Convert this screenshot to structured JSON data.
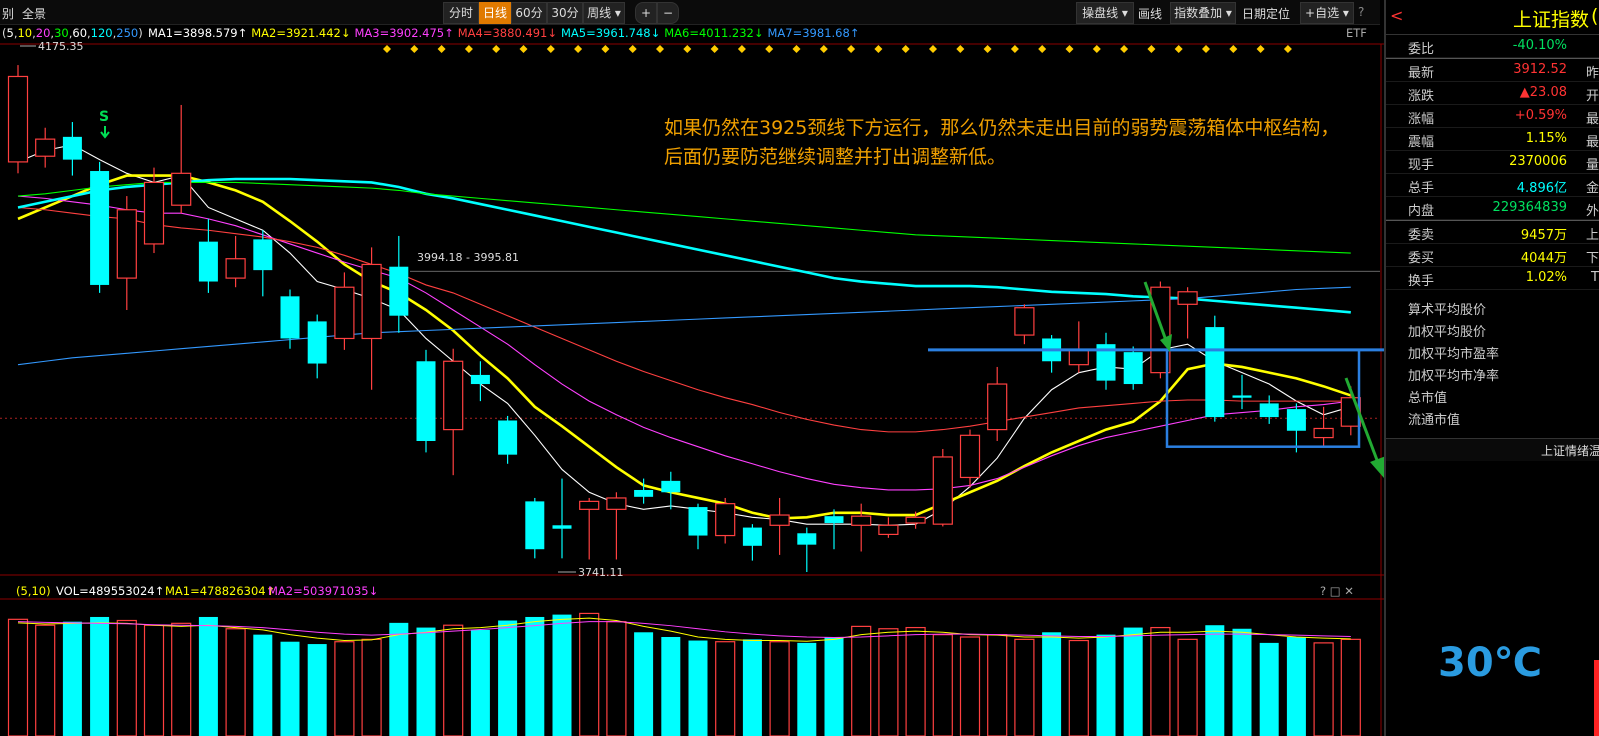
{
  "toolbar": {
    "left_cut": "别",
    "full_view": "全景",
    "period_tabs": [
      "分时",
      "日线",
      "60分",
      "30分",
      "周线"
    ],
    "active_period": "日线",
    "plus": "+",
    "minus": "−",
    "panel_line": "操盘线",
    "draw_line": "画线",
    "index_overlay": "指数叠加",
    "date_locate": "日期定位",
    "watchlist": "+自选",
    "help": "?",
    "collapse": "❯❮"
  },
  "ma_legend": {
    "params_prefix": "(",
    "params": [
      {
        "text": "5",
        "color": "#ffffff"
      },
      {
        "text": "10",
        "color": "#ffff00"
      },
      {
        "text": "20",
        "color": "#ff40ff"
      },
      {
        "text": "30",
        "color": "#00ff00"
      },
      {
        "text": "60",
        "color": "#ffffff"
      },
      {
        "text": "120",
        "color": "#00ffff"
      },
      {
        "text": "250",
        "color": "#3399ff"
      }
    ],
    "items": [
      {
        "text": "MA1=3898.579↑",
        "color": "#ffffff"
      },
      {
        "text": "MA2=3921.442↓",
        "color": "#ffff00"
      },
      {
        "text": "MA3=3902.475↑",
        "color": "#ff40ff"
      },
      {
        "text": "MA4=3880.491↓",
        "color": "#ff4040"
      },
      {
        "text": "MA5=3961.748↓",
        "color": "#00ffff"
      },
      {
        "text": "MA6=4011.232↓",
        "color": "#00ff00"
      },
      {
        "text": "MA7=3981.68↑",
        "color": "#3399ff"
      }
    ],
    "etf": "ETF",
    "help": "?"
  },
  "volume_legend": {
    "params": "(5,10)",
    "vol": "VOL=489553024↑",
    "ma1": "MA1=478826304↑",
    "ma2": "MA2=503971035↓",
    "controls": "? □ ✕"
  },
  "annotation": {
    "line1": "如果仍然在3925颈线下方运行，那么仍然未走出目前的弱势震荡箱体中枢结构，",
    "line2": "后面仍要防范继续调整并打出调整新低。"
  },
  "chart_data": {
    "type": "candlestick",
    "title": "",
    "xlabel": "",
    "ylabel": "",
    "ylim": [
      3730,
      4190
    ],
    "high_label": "4175.35",
    "low_label": "3741.11",
    "range_label": "3994.18 - 3995.81",
    "reference_price": 3925,
    "candles": [
      {
        "o": 4090,
        "c": 4165,
        "h": 4175,
        "l": 4080
      },
      {
        "o": 4095,
        "c": 4110,
        "h": 4120,
        "l": 4085
      },
      {
        "o": 4112,
        "c": 4092,
        "h": 4125,
        "l": 4078
      },
      {
        "o": 4082,
        "c": 3982,
        "h": 4090,
        "l": 3975
      },
      {
        "o": 3988,
        "c": 4048,
        "h": 4060,
        "l": 3960
      },
      {
        "o": 4018,
        "c": 4072,
        "h": 4085,
        "l": 4010
      },
      {
        "o": 4052,
        "c": 4080,
        "h": 4140,
        "l": 4045
      },
      {
        "o": 4020,
        "c": 3985,
        "h": 4040,
        "l": 3975
      },
      {
        "o": 3988,
        "c": 4005,
        "h": 4025,
        "l": 3980
      },
      {
        "o": 4022,
        "c": 3995,
        "h": 4030,
        "l": 3972
      },
      {
        "o": 3972,
        "c": 3935,
        "h": 3978,
        "l": 3926
      },
      {
        "o": 3950,
        "c": 3913,
        "h": 3956,
        "l": 3900
      },
      {
        "o": 3935,
        "c": 3980,
        "h": 3993,
        "l": 3925
      },
      {
        "o": 3935,
        "c": 4000,
        "h": 4015,
        "l": 3890
      },
      {
        "o": 3998,
        "c": 3955,
        "h": 4025,
        "l": 3940
      },
      {
        "o": 3915,
        "c": 3845,
        "h": 3925,
        "l": 3835
      },
      {
        "o": 3855,
        "c": 3915,
        "h": 3926,
        "l": 3815
      },
      {
        "o": 3903,
        "c": 3895,
        "h": 3915,
        "l": 3880
      },
      {
        "o": 3863,
        "c": 3833,
        "h": 3867,
        "l": 3825
      },
      {
        "o": 3792,
        "c": 3750,
        "h": 3795,
        "l": 3742
      },
      {
        "o": 3771,
        "c": 3768,
        "h": 3812,
        "l": 3742
      },
      {
        "o": 3785,
        "c": 3792,
        "h": 3795,
        "l": 3741
      },
      {
        "o": 3785,
        "c": 3795,
        "h": 3800,
        "l": 3741
      },
      {
        "o": 3802,
        "c": 3796,
        "h": 3812,
        "l": 3790
      },
      {
        "o": 3810,
        "c": 3800,
        "h": 3818,
        "l": 3785
      },
      {
        "o": 3787,
        "c": 3762,
        "h": 3790,
        "l": 3750
      },
      {
        "o": 3762,
        "c": 3790,
        "h": 3795,
        "l": 3755
      },
      {
        "o": 3769,
        "c": 3753,
        "h": 3772,
        "l": 3740
      },
      {
        "o": 3771,
        "c": 3780,
        "h": 3795,
        "l": 3745
      },
      {
        "o": 3764,
        "c": 3754,
        "h": 3769,
        "l": 3730
      },
      {
        "o": 3779,
        "c": 3773,
        "h": 3785,
        "l": 3750
      },
      {
        "o": 3771,
        "c": 3779,
        "h": 3790,
        "l": 3748
      },
      {
        "o": 3763,
        "c": 3771,
        "h": 3778,
        "l": 3760
      },
      {
        "o": 3773,
        "c": 3778,
        "h": 3783,
        "l": 3768
      },
      {
        "o": 3772,
        "c": 3831,
        "h": 3838,
        "l": 3770
      },
      {
        "o": 3813,
        "c": 3850,
        "h": 3855,
        "l": 3804
      },
      {
        "o": 3855,
        "c": 3895,
        "h": 3910,
        "l": 3845
      },
      {
        "o": 3938,
        "c": 3962,
        "h": 3965,
        "l": 3930
      },
      {
        "o": 3935,
        "c": 3915,
        "h": 3938,
        "l": 3905
      },
      {
        "o": 3912,
        "c": 3925,
        "h": 3950,
        "l": 3905
      },
      {
        "o": 3930,
        "c": 3898,
        "h": 3940,
        "l": 3890
      },
      {
        "o": 3923,
        "c": 3895,
        "h": 3928,
        "l": 3890
      },
      {
        "o": 3905,
        "c": 3980,
        "h": 3985,
        "l": 3900
      },
      {
        "o": 3965,
        "c": 3976,
        "h": 3980,
        "l": 3935
      },
      {
        "o": 3945,
        "c": 3866,
        "h": 3955,
        "l": 3862
      },
      {
        "o": 3885,
        "c": 3883,
        "h": 3903,
        "l": 3873
      },
      {
        "o": 3878,
        "c": 3866,
        "h": 3885,
        "l": 3860
      },
      {
        "o": 3873,
        "c": 3854,
        "h": 3878,
        "l": 3835
      },
      {
        "o": 3848,
        "c": 3856,
        "h": 3875,
        "l": 3840
      },
      {
        "o": 3858,
        "c": 3883,
        "h": 3893,
        "l": 3850
      }
    ],
    "ma_lines": [
      {
        "name": "MA1",
        "color": "#ffffff",
        "values": [
          4090,
          4100,
          4105,
          4092,
          4080,
          4072,
          4078,
          4050,
          4040,
          4030,
          4010,
          3985,
          3978,
          3970,
          3960,
          3935,
          3915,
          3895,
          3878,
          3850,
          3820,
          3800,
          3790,
          3785,
          3788,
          3785,
          3782,
          3778,
          3776,
          3772,
          3772,
          3772,
          3771,
          3772,
          3785,
          3805,
          3830,
          3865,
          3890,
          3905,
          3910,
          3908,
          3925,
          3930,
          3915,
          3905,
          3895,
          3880,
          3868,
          3875
        ]
      },
      {
        "name": "MA2",
        "color": "#ffff00",
        "values": [
          4040,
          4050,
          4060,
          4070,
          4078,
          4078,
          4078,
          4072,
          4065,
          4055,
          4038,
          4020,
          4000,
          3985,
          3975,
          3960,
          3942,
          3920,
          3900,
          3875,
          3858,
          3840,
          3822,
          3806,
          3800,
          3795,
          3790,
          3782,
          3777,
          3778,
          3782,
          3782,
          3780,
          3780,
          3790,
          3800,
          3810,
          3823,
          3835,
          3845,
          3855,
          3862,
          3880,
          3908,
          3913,
          3910,
          3905,
          3900,
          3893,
          3885
        ]
      },
      {
        "name": "MA3",
        "color": "#ff40ff",
        "values": [
          4060,
          4058,
          4055,
          4052,
          4048,
          4045,
          4045,
          4040,
          4034,
          4026,
          4018,
          4010,
          4002,
          3995,
          3988,
          3975,
          3960,
          3945,
          3930,
          3912,
          3895,
          3880,
          3868,
          3857,
          3848,
          3840,
          3832,
          3825,
          3818,
          3812,
          3807,
          3804,
          3802,
          3802,
          3803,
          3806,
          3812,
          3822,
          3832,
          3841,
          3848,
          3853,
          3858,
          3863,
          3868,
          3870,
          3872,
          3875,
          3877,
          3880
        ]
      },
      {
        "name": "MA4",
        "color": "#ff4040",
        "values": [
          4050,
          4048,
          4045,
          4042,
          4040,
          4035,
          4032,
          4030,
          4027,
          4024,
          4020,
          4015,
          4008,
          4000,
          3992,
          3982,
          3975,
          3965,
          3955,
          3945,
          3935,
          3925,
          3915,
          3906,
          3898,
          3890,
          3883,
          3877,
          3870,
          3864,
          3859,
          3855,
          3853,
          3853,
          3855,
          3858,
          3862,
          3866,
          3870,
          3874,
          3876,
          3878,
          3880,
          3881,
          3881,
          3880,
          3880,
          3880,
          3880,
          3880
        ]
      },
      {
        "name": "MA5",
        "color": "#00ffff",
        "values": [
          4050,
          4055,
          4060,
          4065,
          4068,
          4070,
          4072,
          4074,
          4075,
          4075,
          4075,
          4074,
          4073,
          4072,
          4068,
          4062,
          4058,
          4053,
          4048,
          4043,
          4038,
          4033,
          4028,
          4023,
          4018,
          4013,
          4008,
          4003,
          3998,
          3993,
          3988,
          3985,
          3983,
          3981,
          3981,
          3981,
          3980,
          3978,
          3976,
          3975,
          3974,
          3972,
          3971,
          3970,
          3968,
          3966,
          3964,
          3962,
          3960,
          3958
        ]
      },
      {
        "name": "MA6",
        "color": "#00ff00",
        "values": [
          4060,
          4062,
          4065,
          4068,
          4070,
          4072,
          4072,
          4072,
          4072,
          4071,
          4070,
          4069,
          4068,
          4067,
          4065,
          4062,
          4060,
          4058,
          4056,
          4054,
          4052,
          4050,
          4048,
          4046,
          4044,
          4042,
          4040,
          4038,
          4036,
          4034,
          4032,
          4030,
          4028,
          4026,
          4025,
          4024,
          4023,
          4022,
          4021,
          4020,
          4019,
          4018,
          4017,
          4016,
          4015,
          4014,
          4013,
          4012,
          4011,
          4010
        ]
      },
      {
        "name": "MA7",
        "color": "#3399ff",
        "values": [
          3912,
          3915,
          3918,
          3920,
          3922,
          3924,
          3926,
          3928,
          3930,
          3932,
          3934,
          3936,
          3938,
          3940,
          3941,
          3942,
          3943,
          3944,
          3945,
          3946,
          3947,
          3948,
          3949,
          3950,
          3951,
          3952,
          3953,
          3954,
          3955,
          3956,
          3957,
          3958,
          3959,
          3960,
          3961,
          3962,
          3963,
          3964,
          3965,
          3966,
          3967,
          3968,
          3969,
          3970,
          3972,
          3974,
          3976,
          3978,
          3979,
          3980
        ]
      }
    ],
    "volume": {
      "ylim": [
        0,
        560
      ],
      "values": [
        495,
        470,
        485,
        505,
        490,
        470,
        478,
        505,
        455,
        430,
        400,
        390,
        400,
        410,
        480,
        460,
        470,
        450,
        490,
        505,
        515,
        520,
        485,
        440,
        420,
        405,
        400,
        410,
        400,
        395,
        420,
        465,
        455,
        460,
        430,
        420,
        430,
        410,
        440,
        405,
        430,
        460,
        460,
        410,
        470,
        455,
        395,
        420,
        395,
        410
      ],
      "ma5": [
        480,
        475,
        478,
        480,
        478,
        470,
        465,
        470,
        460,
        450,
        430,
        415,
        405,
        408,
        430,
        440,
        455,
        460,
        470,
        485,
        495,
        500,
        490,
        465,
        445,
        420,
        410,
        405,
        405,
        402,
        410,
        430,
        440,
        445,
        440,
        430,
        428,
        420,
        420,
        415,
        420,
        430,
        440,
        440,
        445,
        440,
        430,
        420,
        415,
        412
      ],
      "ma10": [
        485,
        482,
        480,
        478,
        476,
        472,
        470,
        468,
        465,
        460,
        450,
        440,
        432,
        428,
        432,
        438,
        445,
        452,
        460,
        468,
        478,
        485,
        485,
        478,
        468,
        455,
        442,
        432,
        425,
        420,
        418,
        420,
        425,
        430,
        432,
        432,
        430,
        428,
        425,
        422,
        422,
        425,
        428,
        430,
        432,
        432,
        430,
        428,
        425,
        422
      ]
    }
  },
  "markers": {
    "sell": "S"
  },
  "quote_panel": {
    "back": "<",
    "title": "上证指数",
    "title_cut": "(",
    "rows": [
      {
        "k": "委比",
        "v": "-40.10%",
        "vc": "#00e060",
        "x": ""
      },
      {
        "k": "最新",
        "v": "3912.52",
        "vc": "#ff3333",
        "x": "昨"
      },
      {
        "k": "涨跌",
        "v": "▲23.08",
        "vc": "#ff3333",
        "x": "开"
      },
      {
        "k": "涨幅",
        "v": "+0.59%",
        "vc": "#ff3333",
        "x": "最"
      },
      {
        "k": "震幅",
        "v": "1.15%",
        "vc": "#ffff00",
        "x": "最"
      },
      {
        "k": "现手",
        "v": "2370006",
        "vc": "#ffff00",
        "x": "量"
      },
      {
        "k": "总手",
        "v": "4.896亿",
        "vc": "#00ffff",
        "x": "金"
      },
      {
        "k": "内盘",
        "v": "229364839",
        "vc": "#00e060",
        "x": "外"
      },
      {
        "k": "委卖",
        "v": "9457万",
        "vc": "#ffff00",
        "x": "上"
      },
      {
        "k": "委买",
        "v": "4044万",
        "vc": "#ffff00",
        "x": "下"
      },
      {
        "k": "换手",
        "v": "1.02%",
        "vc": "#ffff00",
        "x": "T"
      }
    ],
    "stats": [
      "算术平均股价",
      "加权平均股价",
      "加权平均市盈率",
      "加权平均市净率",
      "总市值",
      "流通市值"
    ],
    "sentiment_title": "上证情绪温",
    "temperature": "30℃"
  }
}
